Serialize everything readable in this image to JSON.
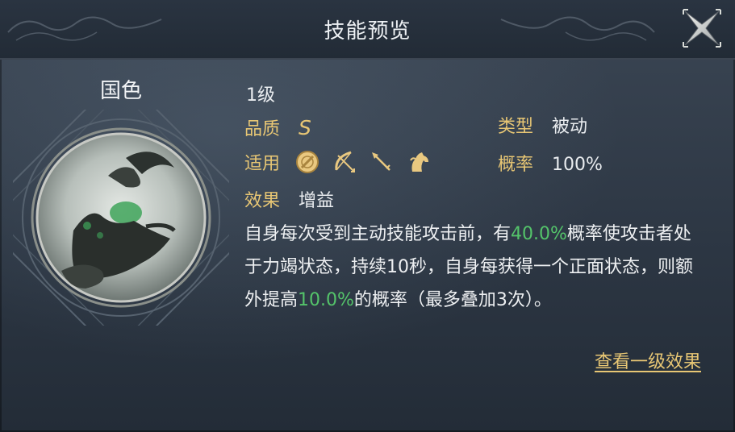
{
  "header": {
    "title": "技能预览"
  },
  "skill": {
    "name": "国色",
    "level": "1级",
    "quality_label": "品质",
    "quality_value": "S",
    "type_label": "类型",
    "type_value": "被动",
    "apply_label": "适用",
    "apply_icons": [
      "shield-icon",
      "bow-icon",
      "spear-icon",
      "horse-icon"
    ],
    "rate_label": "概率",
    "rate_value": "100%",
    "effect_label": "效果",
    "effect_value": "增益",
    "description": {
      "part1": "自身每次受到主动技能攻击前，有",
      "hl1": "40.0%",
      "part2": "概率使攻击者处于力竭状态，持续10秒，自身每获得一个正面状态，则额外提高",
      "hl2": "10.0%",
      "part3": "的概率（最多叠加3次）。"
    }
  },
  "footer": {
    "link_label": "查看一级效果"
  },
  "colors": {
    "gold": "#e7c674",
    "highlight": "#54c46a",
    "text": "#eef0f2"
  }
}
